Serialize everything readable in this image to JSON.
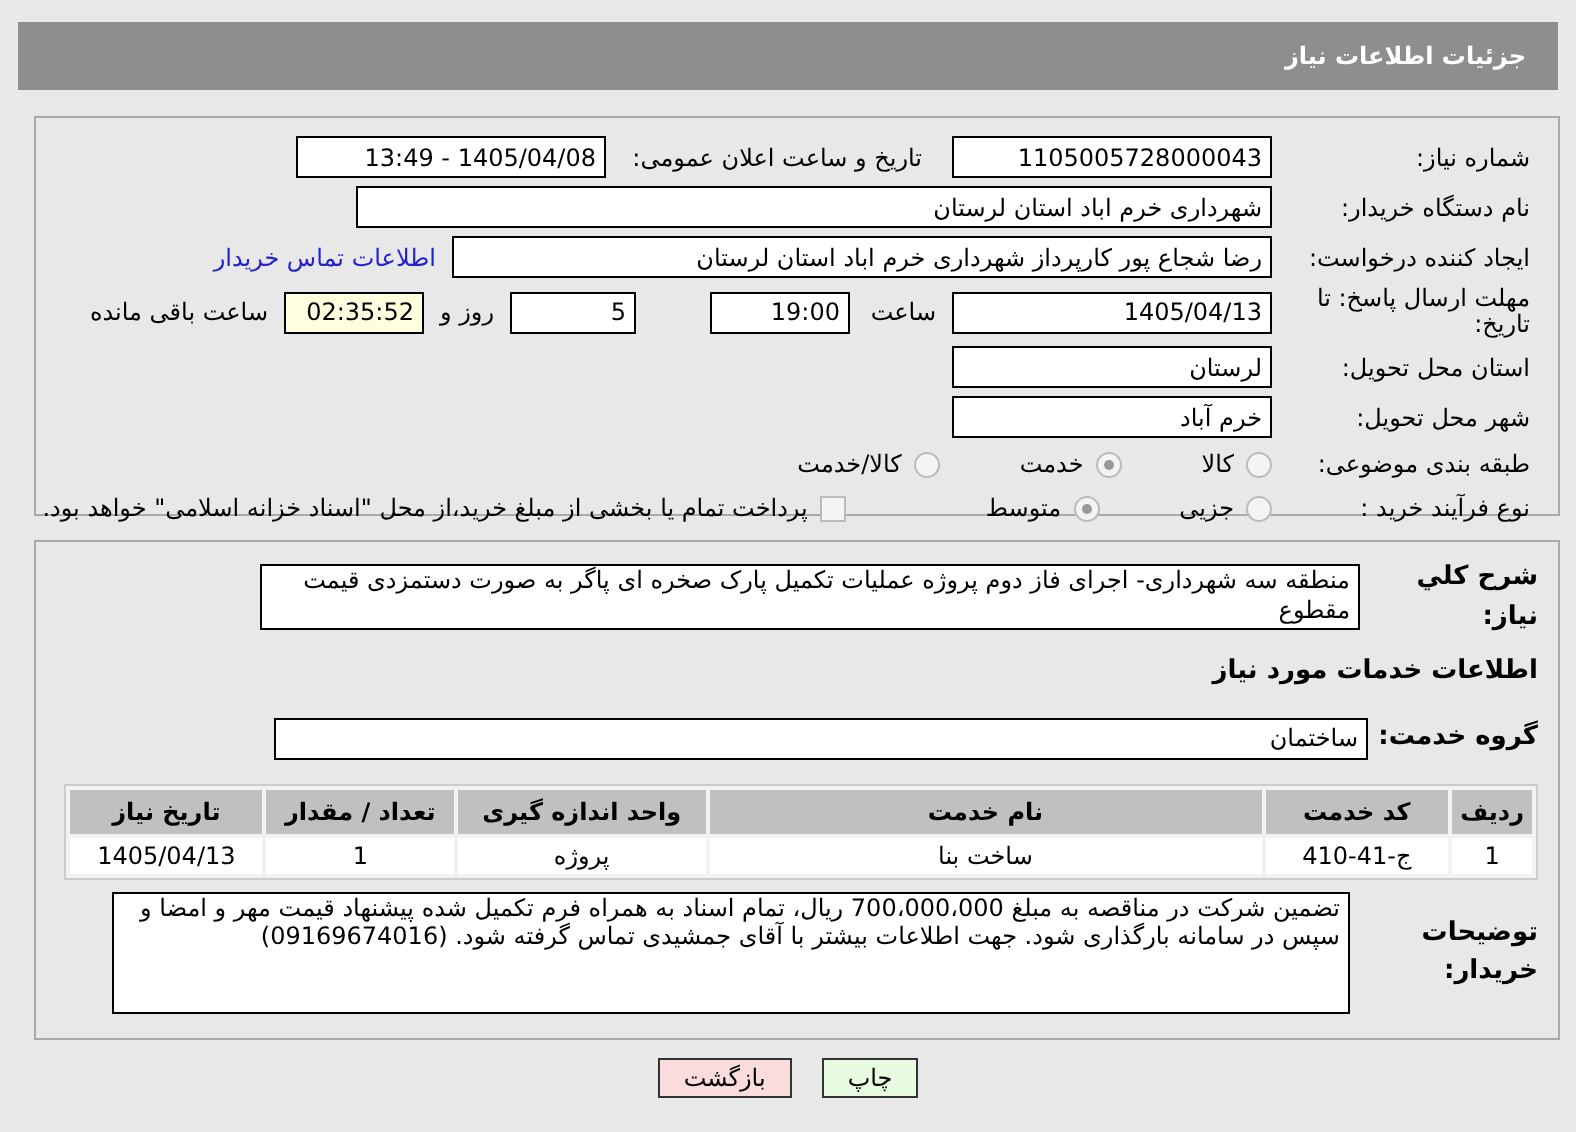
{
  "header": {
    "title": "جزئیات اطلاعات نیاز"
  },
  "fields": {
    "need_number": {
      "label": "شماره نیاز:",
      "value": "1105005728000043"
    },
    "announce": {
      "label": "تاریخ و ساعت اعلان عمومی:",
      "value": "1405/04/08 - 13:49"
    },
    "buyer": {
      "label": "نام دستگاه خریدار:",
      "value": "شهرداری خرم اباد استان لرستان"
    },
    "creator": {
      "label": "ایجاد کننده درخواست:",
      "value": "رضا شجاع پور کارپرداز شهرداری خرم اباد استان لرستان",
      "link": "اطلاعات تماس خریدار"
    },
    "deadline": {
      "label": "مهلت ارسال پاسخ: تا تاریخ:",
      "date": "1405/04/13",
      "time_label": "ساعت",
      "time": "19:00",
      "days": "5",
      "days_label": "روز و",
      "remaining": "02:35:52",
      "remaining_label": "ساعت باقی مانده"
    },
    "province": {
      "label": "استان محل تحویل:",
      "value": "لرستان"
    },
    "city": {
      "label": "شهر محل تحویل:",
      "value": "خرم آباد"
    }
  },
  "classification": {
    "label": "طبقه بندی موضوعی:",
    "options": [
      {
        "label": "کالا",
        "selected": false
      },
      {
        "label": "خدمت",
        "selected": true
      },
      {
        "label": "کالا/خدمت",
        "selected": false
      }
    ]
  },
  "purchase_type": {
    "label": "نوع فرآیند خرید :",
    "options": [
      {
        "label": "جزیی",
        "selected": false
      },
      {
        "label": "متوسط",
        "selected": true
      }
    ],
    "payment": {
      "checked": false,
      "label": "پرداخت تمام یا بخشی از مبلغ خرید،از محل \"اسناد خزانه اسلامی\" خواهد بود."
    }
  },
  "summary": {
    "label": "شرح کلي نیاز:",
    "value": "منطقه سه شهرداری- اجرای فاز دوم پروژه عملیات تکمیل پارک صخره ای پاگر به صورت دستمزدی قیمت مقطوع"
  },
  "services_title": "اطلاعات خدمات مورد نیاز",
  "service_group": {
    "label": "گروه خدمت:",
    "value": "ساختمان"
  },
  "table": {
    "columns": [
      "ردیف",
      "کد خدمت",
      "نام خدمت",
      "واحد اندازه گیری",
      "تعداد / مقدار",
      "تاریخ نیاز"
    ],
    "rows": [
      [
        "1",
        "ج-41-410",
        "ساخت بنا",
        "پروژه",
        "1",
        "1405/04/13"
      ]
    ]
  },
  "notes": {
    "label": "توضیحات خریدار:",
    "value": "تضمین شرکت در مناقصه به مبلغ 700،000،000 ریال، تمام اسناد به همراه فرم تکمیل شده پیشنهاد قیمت مهر و امضا و سپس در سامانه بارگذاری شود. جهت اطلاعات بیشتر با آقای جمشیدی تماس گرفته شود. (09169674016)"
  },
  "buttons": [
    {
      "kind": "print",
      "label": "چاپ"
    },
    {
      "kind": "back",
      "label": "بازگشت"
    }
  ]
}
